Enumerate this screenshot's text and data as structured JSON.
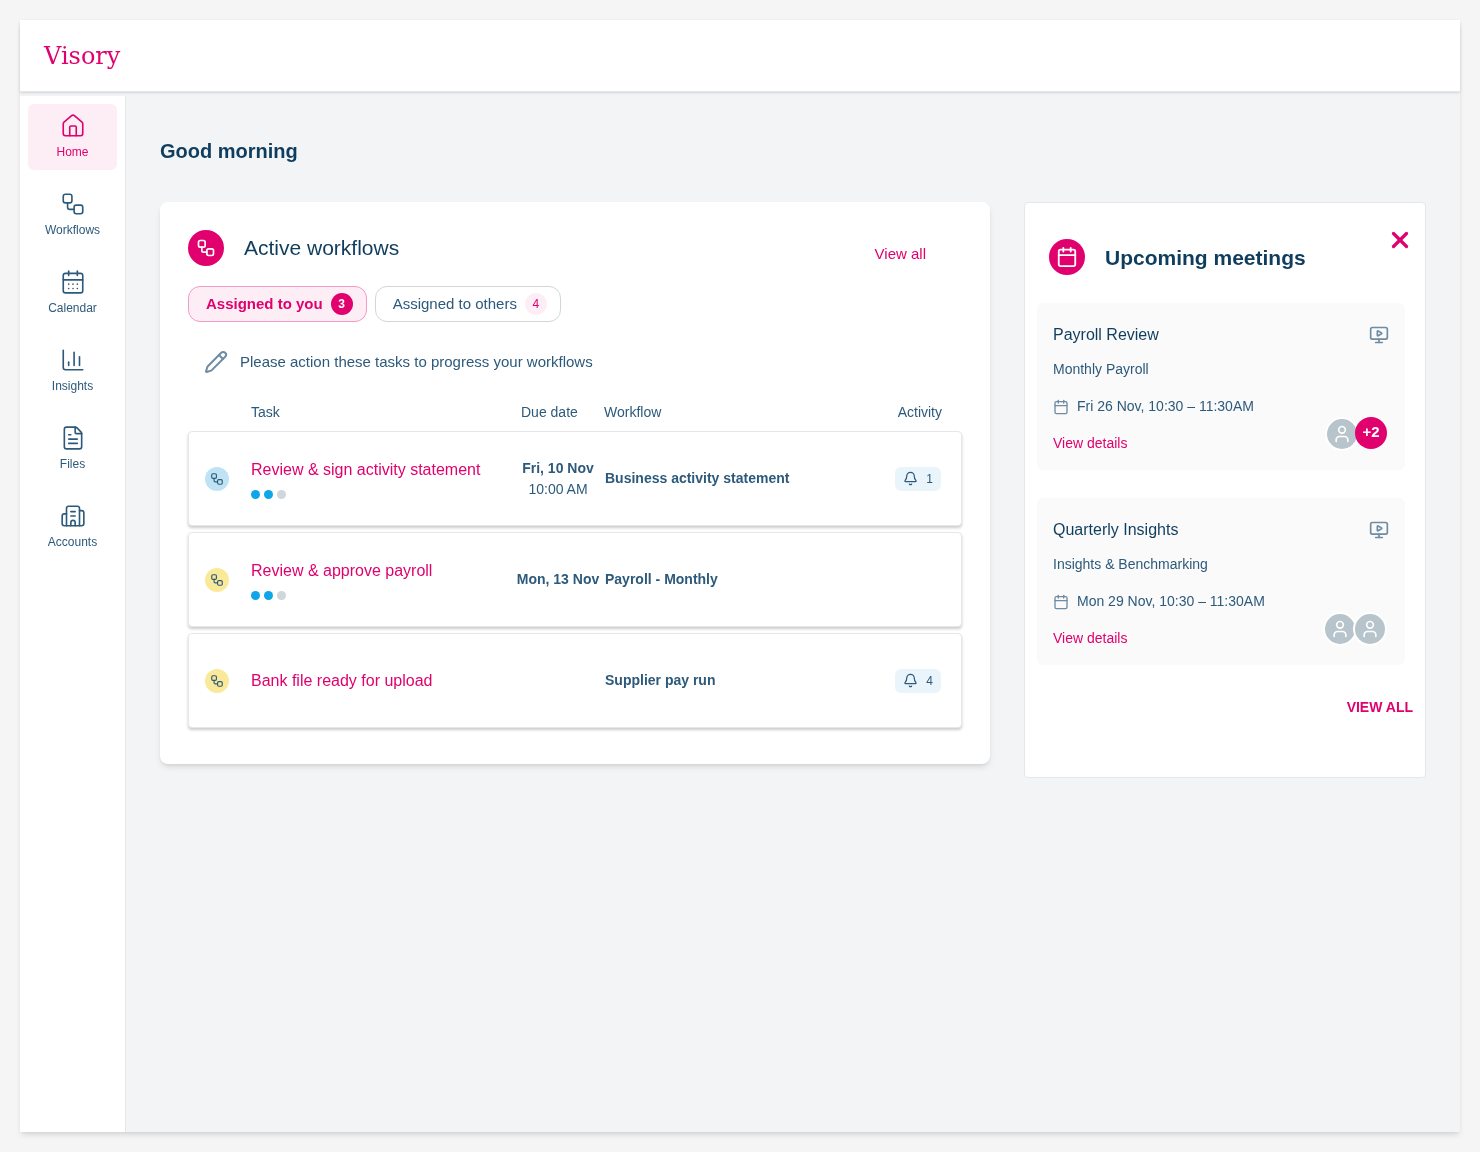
{
  "brand": "Visory",
  "sidebar": {
    "items": [
      {
        "label": "Home",
        "selected": true
      },
      {
        "label": "Workflows",
        "selected": false
      },
      {
        "label": "Calendar",
        "selected": false
      },
      {
        "label": "Insights",
        "selected": false
      },
      {
        "label": "Files",
        "selected": false
      },
      {
        "label": "Accounts",
        "selected": false
      }
    ]
  },
  "greeting": "Good morning",
  "workflows": {
    "title": "Active workflows",
    "view_all": "View all",
    "tabs": [
      {
        "label": "Assigned to you",
        "count": "3",
        "selected": true
      },
      {
        "label": "Assigned to others",
        "count": "4",
        "selected": false
      }
    ],
    "instruction": "Please action these tasks to progress your workflows",
    "columns": [
      "Task",
      "Due date",
      "Workflow",
      "Activity"
    ],
    "rows": [
      {
        "task": "Review & sign activity statement",
        "color": "#bfe3f5",
        "steps": [
          {
            "done": true
          },
          {
            "done": true
          },
          {
            "done": false
          }
        ],
        "due": [
          "Fri, 10 Nov",
          "10:00 AM"
        ],
        "workflow": "Business activity statement",
        "activity": "1"
      },
      {
        "task": "Review & approve payroll",
        "color": "#fbe99a",
        "steps": [
          {
            "done": true
          },
          {
            "done": true
          },
          {
            "done": false
          }
        ],
        "due": [
          "Mon, 13 Nov"
        ],
        "workflow": "Payroll - Monthly"
      },
      {
        "task": "Bank file ready for upload",
        "color": "#fbe99a",
        "workflow": "Supplier pay run",
        "activity": "4"
      }
    ]
  },
  "meetings": {
    "title": "Upcoming meetings",
    "view_all": "VIEW ALL",
    "items": [
      {
        "title": "Payroll Review",
        "subtitle": "Monthly Payroll",
        "when": "Fri 26 Nov, 10:30 – 11:30AM",
        "link": "View details",
        "avatars": [
          {
            "kind": "person"
          }
        ],
        "more": "+2"
      },
      {
        "title": "Quarterly Insights",
        "subtitle": "Insights & Benchmarking",
        "when": "Mon 29 Nov, 10:30 – 11:30AM",
        "link": "View details",
        "avatars": [
          {
            "kind": "person"
          },
          {
            "kind": "person"
          }
        ]
      }
    ]
  }
}
